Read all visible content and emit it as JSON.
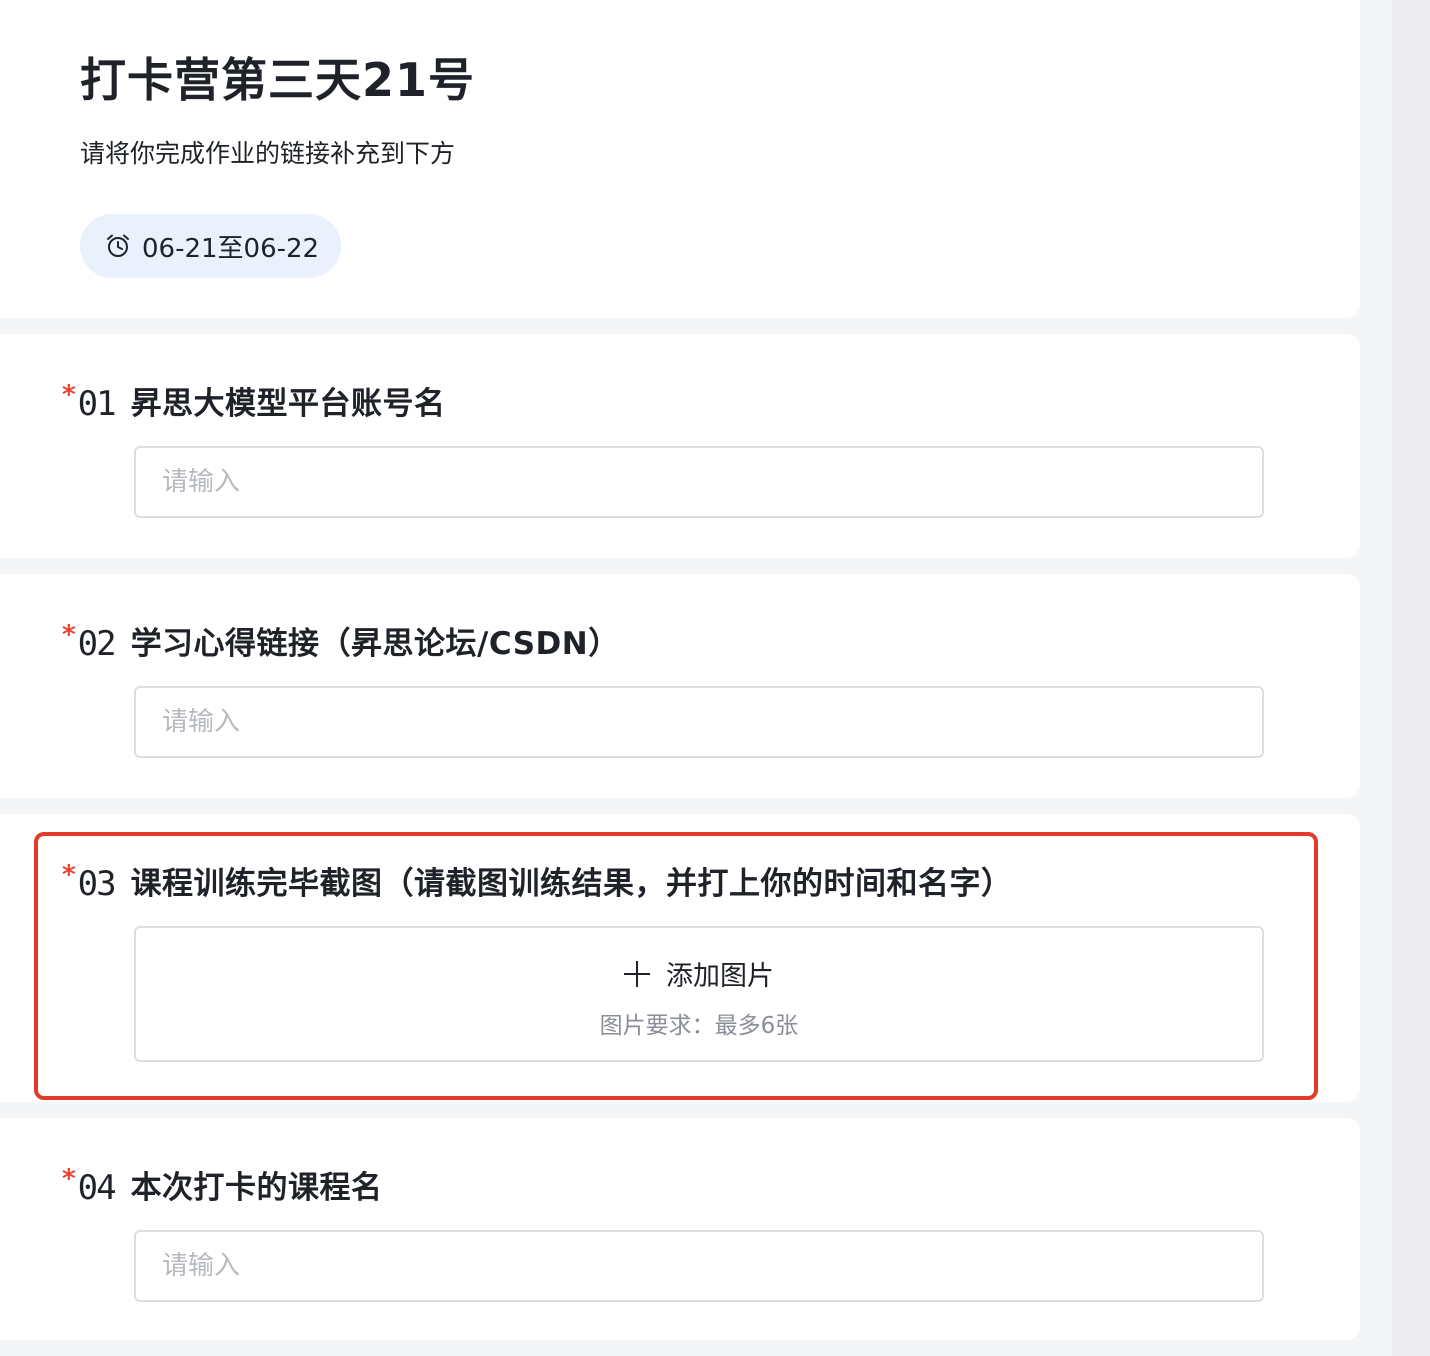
{
  "header": {
    "title": "打卡营第三天21号",
    "subtitle": "请将你完成作业的链接补充到下方",
    "date_range": "06-21至06-22",
    "date_icon": "alarm-clock-icon"
  },
  "questions": [
    {
      "number": "01",
      "required_mark": "*",
      "label": "昇思大模型平台账号名",
      "input_type": "text",
      "placeholder": "请输入",
      "value": ""
    },
    {
      "number": "02",
      "required_mark": "*",
      "label": "学习心得链接（昇思论坛/CSDN）",
      "input_type": "text",
      "placeholder": "请输入",
      "value": ""
    },
    {
      "number": "03",
      "required_mark": "*",
      "label": "课程训练完毕截图（请截图训练结果，并打上你的时间和名字）",
      "input_type": "image-upload",
      "upload_label": "添加图片",
      "upload_hint": "图片要求：最多6张",
      "highlighted": true
    },
    {
      "number": "04",
      "required_mark": "*",
      "label": "本次打卡的课程名",
      "input_type": "text",
      "placeholder": "请输入",
      "value": ""
    }
  ],
  "colors": {
    "page_background": "#f4f5f7",
    "card_background": "#ffffff",
    "required_star": "#e8412c",
    "highlight_border": "#e23b2a",
    "date_pill_background": "#eaf1fd",
    "placeholder_text": "#b6b9bf",
    "hint_text": "#8a8e96"
  }
}
